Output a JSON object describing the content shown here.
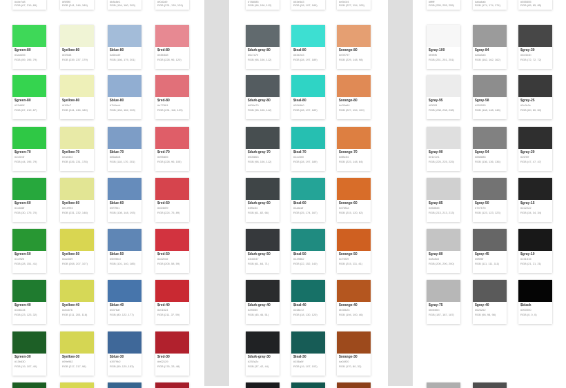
{
  "top_partial": [
    [
      {
        "hex": "#d4e7d8",
        "rgb": "RGB (67, 219, 89)"
      },
      {
        "hex": "#f5f5f0",
        "rgb": "RGB (241, 246, 189)"
      },
      {
        "hex": "#b8c8e1",
        "rgb": "RGB (154, 180, 209)"
      },
      {
        "hex": "#f0d2d9",
        "rgb": "RGB (231, 139, 129)"
      }
    ],
    [
      {
        "hex": "#788085",
        "rgb": "RGB (98, 106, 112)"
      },
      {
        "hex": "#45e5d3",
        "rgb": "RGB (28, 197, 189)"
      },
      {
        "hex": "#e5b1f4",
        "rgb": "RGB (227, 154, 105)"
      }
    ],
    [
      {
        "hex": "#ffffff",
        "rgb": "RGB (255, 255, 255)"
      },
      {
        "hex": "#ababab",
        "rgb": "RGB (174, 174, 174)"
      },
      {
        "hex": "#555555",
        "rgb": "RGB (85, 85, 85)"
      }
    ]
  ],
  "sections": [
    [
      [
        {
          "name": "$green-80",
          "hex": "#3ad455",
          "rgb": "RGB (59, 195, 79)",
          "color": "#3ed858"
        },
        {
          "name": "$yellow-80",
          "hex": "#f2f5d8",
          "rgb": "RGB (239, 237, 179)",
          "color": "#f0f4d5"
        },
        {
          "name": "$blue-80",
          "hex": "#a6bcd9",
          "rgb": "RGB (166, 179, 201)",
          "color": "#a3bcd9"
        },
        {
          "name": "$red-80",
          "hex": "#e8b3d8",
          "rgb": "RGB (228, 96, 120)",
          "color": "#e78992"
        }
      ],
      [
        {
          "name": "$green-80",
          "hex": "#23d65f",
          "rgb": "RGB (67, 219, 87)",
          "color": "#35d44f"
        },
        {
          "name": "$yellow-80",
          "hex": "#f1f5c7",
          "rgb": "RGB (241, 246, 180)",
          "color": "#eef0b8"
        },
        {
          "name": "$blue-80",
          "hex": "#7b9ecb",
          "rgb": "RGB (154, 182, 203)",
          "color": "#91aed2"
        },
        {
          "name": "$red-80",
          "hex": "#e77681",
          "rgb": "RGB (231, 118, 129)",
          "color": "#e17079"
        }
      ],
      [
        {
          "name": "$green-70",
          "hex": "#2c5e4f",
          "rgb": "RGB (44, 195, 79)",
          "color": "#2fc845"
        },
        {
          "name": "$yellow-70",
          "hex": "#eaedb2",
          "rgb": "RGB (226, 231, 178)",
          "color": "#e8eaa7"
        },
        {
          "name": "$blue-70",
          "hex": "#86a6c8",
          "rgb": "RGB (118, 170, 201)",
          "color": "#7d9dc6"
        },
        {
          "name": "$red-70",
          "hex": "#d95d65",
          "rgb": "RGB (228, 96, 105)",
          "color": "#df5e68"
        }
      ],
      [
        {
          "name": "$green-60",
          "hex": "#1c6d8f",
          "rgb": "RGB (30, 175, 70)",
          "color": "#27a83d"
        },
        {
          "name": "$yellow-60",
          "hex": "#e1e994",
          "rgb": "RGB (231, 232, 148)",
          "color": "#e2e594"
        },
        {
          "name": "$blue-60",
          "hex": "#5f79b1",
          "rgb": "RGB (108, 148, 193)",
          "color": "#668cbb"
        },
        {
          "name": "$red-60",
          "hex": "#d34b59",
          "rgb": "RGB (224, 75, 89)",
          "color": "#d6444d"
        }
      ],
      [
        {
          "name": "$green-50",
          "hex": "#1c9f2b",
          "rgb": "RGB (28, 151, 41)",
          "color": "#289733"
        },
        {
          "name": "$yellow-50",
          "hex": "#cad349",
          "rgb": "RGB (208, 207, 107)",
          "color": "#d9d651"
        },
        {
          "name": "$blue-50",
          "hex": "#5b9bbd",
          "rgb": "RGB (101, 140, 185)",
          "color": "#5f86b5"
        },
        {
          "name": "$red-50",
          "hex": "#cd2b4d",
          "rgb": "RGB (205, 58, 59)",
          "color": "#d2333f"
        }
      ],
      [
        {
          "name": "$green-40",
          "hex": "#1b8134",
          "rgb": "RGB (23, 123, 32)",
          "color": "#1f7b2f"
        },
        {
          "name": "$yellow-40",
          "hex": "#cbc676",
          "rgb": "RGB (211, 203, 116)",
          "color": "#d6d857"
        },
        {
          "name": "$blue-40",
          "hex": "#5376af",
          "rgb": "RGB (80, 122, 177)",
          "color": "#4775ab"
        },
        {
          "name": "$red-40",
          "hex": "#c01524",
          "rgb": "RGB (211, 37, 59)",
          "color": "#c92932"
        }
      ],
      [
        {
          "name": "$green-30",
          "hex": "#13b630",
          "rgb": "RGB (19, 107, 40)",
          "color": "#1d5f26"
        },
        {
          "name": "$yellow-30",
          "hex": "#99e962",
          "rgb": "RGB (217, 217, 96)",
          "color": "#d5d653"
        },
        {
          "name": "$blue-30",
          "hex": "#3979b2",
          "rgb": "RGB (59, 120, 153)",
          "color": "#3f6899"
        },
        {
          "name": "$red-30",
          "hex": "#b02129",
          "rgb": "RGB (176, 33, 48)",
          "color": "#b1212d"
        }
      ]
    ],
    [
      [
        {
          "name": "$dark-gray-80",
          "hex": "#6c7a7e",
          "rgb": "RGB (98, 106, 112)",
          "color": "#616a6e"
        },
        {
          "name": "$teal-80",
          "hex": "#45e2d3",
          "rgb": "RGB (28, 197, 189)",
          "color": "#3ddfd2"
        },
        {
          "name": "$orange-80",
          "hex": "#e39797",
          "rgb": "RGB (229, 148, 98)",
          "color": "#e59f72"
        }
      ],
      [
        {
          "name": "$dark-gray-80",
          "hex": "#606a70",
          "rgb": "RGB (98, 106, 112)",
          "color": "#545c60"
        },
        {
          "name": "$teal-80",
          "hex": "#20b5b0",
          "rgb": "RGB (28, 197, 189)",
          "color": "#2fd4c5"
        },
        {
          "name": "$orange-80",
          "hex": "#e39a64",
          "rgb": "RGB (227, 154, 100)",
          "color": "#e08a55"
        }
      ],
      [
        {
          "name": "$dark-gray-70",
          "hex": "#505863",
          "rgb": "RGB (98, 106, 112)",
          "color": "#474e50"
        },
        {
          "name": "$teal-70",
          "hex": "#1cc5b0",
          "rgb": "RGB (28, 197, 189)",
          "color": "#26bfb1"
        },
        {
          "name": "$orange-70",
          "hex": "#df8c54",
          "rgb": "RGB (223, 148, 84)",
          "color": "#dd7f41"
        }
      ],
      [
        {
          "name": "$dark-gray-60",
          "hex": "#4f5c54",
          "rgb": "RGB (61, 82, 66)",
          "color": "#3f4547"
        },
        {
          "name": "$teal-60",
          "hex": "#1aacaf",
          "rgb": "RGB (25, 174, 167)",
          "color": "#24a497"
        },
        {
          "name": "$orange-60",
          "hex": "#d76f2a",
          "rgb": "RGB (215, 120, 62)",
          "color": "#d86d29"
        }
      ],
      [
        {
          "name": "$dark-gray-50",
          "hex": "#3d4047",
          "rgb": "RGB (61, 64, 71)",
          "color": "#36393c"
        },
        {
          "name": "$teal-50",
          "hex": "#149882",
          "rgb": "RGB (22, 152, 140)",
          "color": "#1f8b80"
        },
        {
          "name": "$orange-50",
          "hex": "#c76f29",
          "rgb": "RGB (215, 111, 41)",
          "color": "#cf6021"
        }
      ],
      [
        {
          "name": "$dark-gray-40",
          "hex": "#2f3030",
          "rgb": "RGB (45, 46, 51)",
          "color": "#2a2c2d"
        },
        {
          "name": "$teal-40",
          "hex": "#168c72",
          "rgb": "RGB (18, 130, 120)",
          "color": "#177167"
        },
        {
          "name": "$orange-40",
          "hex": "#b35b24",
          "rgb": "RGB (194, 100, 46)",
          "color": "#b4561f"
        }
      ],
      [
        {
          "name": "$dark-gray-30",
          "hex": "#292a2c",
          "rgb": "RGB (37, 42, 44)",
          "color": "#202224"
        },
        {
          "name": "$teal-30",
          "hex": "#156a5f",
          "rgb": "RGB (19, 107, 102)",
          "color": "#175c56"
        },
        {
          "name": "$orange-30",
          "hex": "#a04f20",
          "rgb": "RGB (170, 80, 32)",
          "color": "#9d4a1c"
        }
      ]
    ],
    [
      [
        {
          "name": "$gray-100",
          "hex": "#fbfbfb",
          "rgb": "RGB (251, 251, 251)",
          "color": "#f7f7f7"
        },
        {
          "name": "$gray-84",
          "hex": "#a5a5a5",
          "rgb": "RGB (162, 162, 162)",
          "color": "#9b9b9b"
        },
        {
          "name": "$gray-30",
          "hex": "#4b4b4b",
          "rgb": "RGB (72, 72, 72)",
          "color": "#474747"
        }
      ],
      [
        {
          "name": "$gray-95",
          "hex": "#f3f3f3",
          "rgb": "RGB (238, 238, 238)",
          "color": "#ececec"
        },
        {
          "name": "$gray-58",
          "hex": "#959595",
          "rgb": "RGB (148, 148, 148)",
          "color": "#8d8d8d"
        },
        {
          "name": "$gray-25",
          "hex": "#3c3c3c",
          "rgb": "RGB (60, 60, 60)",
          "color": "#3a3a3a"
        }
      ],
      [
        {
          "name": "$gray-90",
          "hex": "#e1e1e1",
          "rgb": "RGB (225, 225, 225)",
          "color": "#dfdfdf"
        },
        {
          "name": "$gray-54",
          "hex": "#888888",
          "rgb": "RGB (136, 136, 136)",
          "color": "#818181"
        },
        {
          "name": "$gray-20",
          "hex": "#2f2f2f",
          "rgb": "RGB (47, 47, 47)",
          "color": "#2f2f2f"
        }
      ],
      [
        {
          "name": "$gray-85",
          "hex": "#d5d5d5",
          "rgb": "RGB (213, 213, 213)",
          "color": "#d0d0d0"
        },
        {
          "name": "$gray-50",
          "hex": "#7b7b7b",
          "rgb": "RGB (123, 123, 123)",
          "color": "#737373"
        },
        {
          "name": "$gray-15",
          "hex": "#222222",
          "rgb": "RGB (34, 34, 34)",
          "color": "#232323"
        }
      ],
      [
        {
          "name": "$gray-80",
          "hex": "#c8c8c8",
          "rgb": "RGB (200, 200, 200)",
          "color": "#c4c4c4"
        },
        {
          "name": "$gray-45",
          "hex": "#6f6f6f",
          "rgb": "RGB (111, 111, 111)",
          "color": "#666666"
        },
        {
          "name": "$gray-10",
          "hex": "#151515",
          "rgb": "RGB (21, 21, 21)",
          "color": "#181818"
        }
      ],
      [
        {
          "name": "$gray-75",
          "hex": "#bbbbbb",
          "rgb": "RGB (187, 187, 187)",
          "color": "#b7b7b7"
        },
        {
          "name": "$gray-40",
          "hex": "#626262",
          "rgb": "RGB (98, 98, 98)",
          "color": "#5a5a5a"
        },
        {
          "name": "$black",
          "hex": "#000000",
          "rgb": "RGB (0, 0, 0)",
          "color": "#050505"
        }
      ]
    ]
  ],
  "bottom_partial": [
    [
      "#1c5e23",
      "#d8d852",
      "#37658f",
      "#a51d2a"
    ],
    [
      "#1b1c1e",
      "#12574f",
      "#8c3f19"
    ],
    [
      "#aeaeae",
      "#4f4f4f"
    ]
  ]
}
